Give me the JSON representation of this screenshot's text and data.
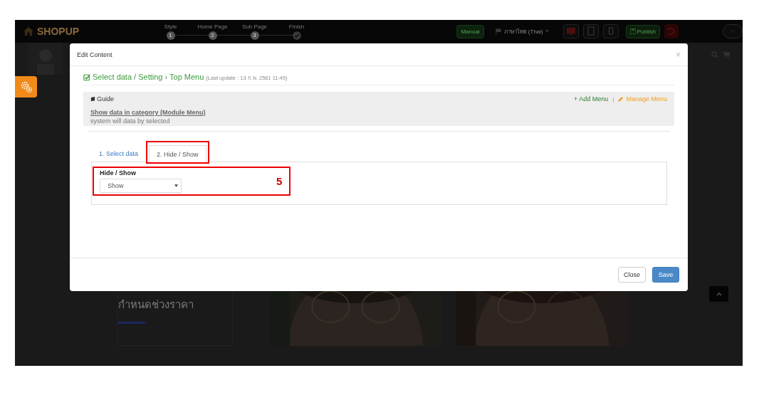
{
  "header": {
    "logo": "SHOPUP",
    "steps": [
      {
        "label": "Style",
        "marker": "1",
        "kind": "number"
      },
      {
        "label": "Home Page",
        "marker": "2",
        "kind": "number"
      },
      {
        "label": "Sub Page",
        "marker": "3",
        "kind": "number"
      },
      {
        "label": "Finish",
        "kind": "check"
      }
    ],
    "manual_button": "Manual",
    "language": "ภาษาไทย (Thai)",
    "publish_button": "Publish"
  },
  "price_filter": {
    "title": "กำหนดช่วงราคา"
  },
  "modal": {
    "title": "Edit Content",
    "close": "×",
    "heading": "Select data / Setting › Top Menu",
    "last_update": "(Last update : 13 ก.พ. 2561 11:49)",
    "guide": {
      "title": "Guide",
      "add_link": "+ Add Menu",
      "separator": "|",
      "manage_link": "Manage Menu",
      "subtitle": "Show data in category (Module Menu)",
      "text": "system will data by selected"
    },
    "tabs": [
      {
        "label": "1. Select data",
        "selected": false,
        "highlighted": false
      },
      {
        "label": "2. Hide / Show",
        "selected": true,
        "highlighted": true
      }
    ],
    "field": {
      "label": "Hide / Show",
      "value": "Show",
      "highlighted": true,
      "callout": "5"
    },
    "buttons": [
      {
        "label": "Close",
        "kind": "default"
      },
      {
        "label": "Save",
        "kind": "primary"
      }
    ]
  }
}
